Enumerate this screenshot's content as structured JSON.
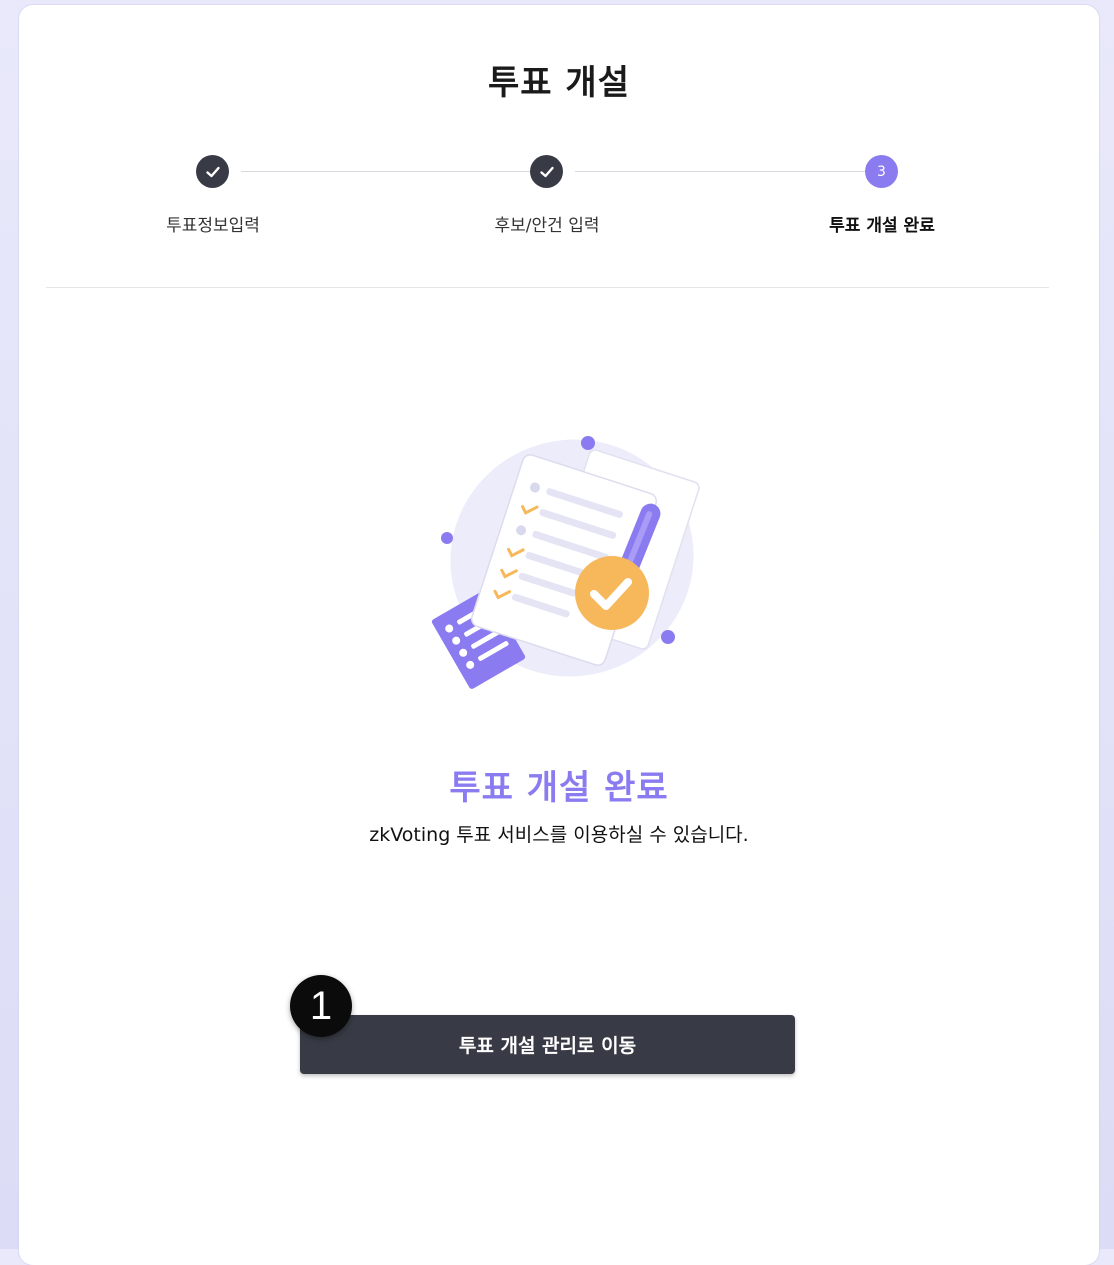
{
  "page": {
    "title": "투표 개설"
  },
  "steps": [
    {
      "label": "투표정보입력",
      "status": "done",
      "icon": "check-icon"
    },
    {
      "label": "후보/안건 입력",
      "status": "done",
      "icon": "check-icon"
    },
    {
      "label": "투표 개설 완료",
      "status": "current",
      "number": "3"
    }
  ],
  "completion": {
    "title": "투표 개설 완료",
    "description": "zkVoting 투표 서비스를 이용하실 수 있습니다.",
    "illustration_icon": "checklist-document-illustration"
  },
  "actions": {
    "manage_label": "투표 개설 관리로 이동"
  },
  "annotation": {
    "marker_number": "1"
  },
  "colors": {
    "accent": "#8a7cf0",
    "dark": "#383b45",
    "check_orange": "#f6b85a"
  }
}
